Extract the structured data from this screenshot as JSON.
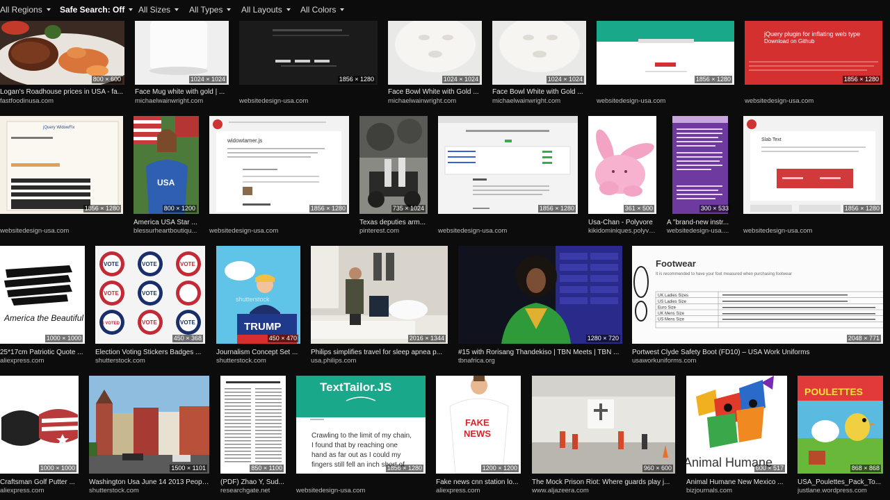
{
  "filters": [
    {
      "label": "All Regions",
      "bold": false
    },
    {
      "label": "Safe Search: Off",
      "bold": true
    },
    {
      "label": "All Sizes",
      "bold": false
    },
    {
      "label": "All Types",
      "bold": false
    },
    {
      "label": "All Layouts",
      "bold": false
    },
    {
      "label": "All Colors",
      "bold": false
    }
  ],
  "row1": [
    {
      "dims": "800 × 600",
      "title": "Logan's Roadhouse prices in USA - fa...",
      "source": "fastfoodinusa.com"
    },
    {
      "dims": "1024 × 1024",
      "title": "Face Mug white with gold | ...",
      "source": "michaelwainwright.com"
    },
    {
      "dims": "1856 × 1280",
      "title": "",
      "source": "websitedesign-usa.com"
    },
    {
      "dims": "1024 × 1024",
      "title": "Face Bowl White with Gold ...",
      "source": "michaelwainwright.com"
    },
    {
      "dims": "1024 × 1024",
      "title": "Face Bowl White with Gold ...",
      "source": "michaelwainwright.com"
    },
    {
      "dims": "1856 × 1280",
      "title": "",
      "source": "websitedesign-usa.com"
    },
    {
      "dims": "1856 × 1280",
      "title": "",
      "source": "websitedesign-usa.com"
    }
  ],
  "row2": [
    {
      "dims": "1856 × 1280",
      "title": "",
      "source": "websitedesign-usa.com"
    },
    {
      "dims": "800 × 1200",
      "title": "America USA Star ...",
      "source": "blessurheartboutiqu..."
    },
    {
      "dims": "1856 × 1280",
      "title": "",
      "source": "websitedesign-usa.com"
    },
    {
      "dims": "735 × 1024",
      "title": "Texas deputies arm...",
      "source": "pinterest.com"
    },
    {
      "dims": "1856 × 1280",
      "title": "",
      "source": "websitedesign-usa.com"
    },
    {
      "dims": "361 × 500",
      "title": "Usa-Chan - Polyvore",
      "source": "kikidominiques.polyvo..."
    },
    {
      "dims": "300 × 533",
      "title": "A \"brand-new instr...",
      "source": "websitedesign-usa...."
    },
    {
      "dims": "1856 × 1280",
      "title": "",
      "source": "websitedesign-usa.com"
    }
  ],
  "row3": [
    {
      "dims": "1000 × 1000",
      "title": "25*17cm Patriotic Quote ...",
      "source": "aliexpress.com"
    },
    {
      "dims": "450 × 368",
      "title": "Election Voting Stickers Badges ...",
      "source": "shutterstock.com"
    },
    {
      "dims": "450 × 470",
      "title": "Journalism Concept Set ...",
      "source": "shutterstock.com"
    },
    {
      "dims": "2016 × 1344",
      "title": "Philips simplifies travel for sleep apnea p...",
      "source": "usa.philips.com"
    },
    {
      "dims": "1280 × 720",
      "title": "#15 with Rorisang Thandekiso | TBN Meets | TBN ...",
      "source": "tbnafrica.org"
    },
    {
      "dims": "2048 × 771",
      "title": "Portwest Clyde Safety Boot (FD10) – USA Work Uniforms",
      "source": "usaworkuniforms.com"
    }
  ],
  "row4": [
    {
      "dims": "1000 × 1000",
      "title": "Craftsman Golf Putter ...",
      "source": "aliexpress.com"
    },
    {
      "dims": "1500 × 1101",
      "title": "Washington Usa June 14 2013 Peopl...",
      "source": "shutterstock.com"
    },
    {
      "dims": "850 × 1100",
      "title": "(PDF) Zhao Y, Sud...",
      "source": "researchgate.net"
    },
    {
      "dims": "1856 × 1280",
      "title": "",
      "source": "websitedesign-usa.com"
    },
    {
      "dims": "1200 × 1200",
      "title": "Fake news cnn station lo...",
      "source": "aliexpress.com"
    },
    {
      "dims": "960 × 600",
      "title": "The Mock Prison Riot: Where guards play j...",
      "source": "www.aljazeera.com"
    },
    {
      "dims": "600 × 517",
      "title": "Animal Humane New Mexico ...",
      "source": "bizjournals.com"
    },
    {
      "dims": "868 × 868",
      "title": "USA_Poulettes_Pack_To...",
      "source": "justlane.wordpress.com"
    }
  ],
  "texts": {
    "jquery_plugin": "jQuery plugin for inflating web type",
    "download_github": "Download on Github",
    "jquery_widow": "jQuery WidowFix",
    "widowtamer": "widowtamer.js",
    "slab_text": "Slab Text",
    "shutterstock": "shutterstock",
    "trump": "TRUMP",
    "footwear": "Footwear",
    "footwear_sub": "It is recommended to have your foot measured when purchasing footwear",
    "uk_ladies": "UK Ladies Sizes",
    "us_ladies": "US Ladies Size",
    "euro_size": "Euro Size",
    "uk_mens": "UK Mens Size",
    "us_mens": "US Mens Size",
    "america_beautiful": "America the Beautiful",
    "vote": "VOTE",
    "voted": "I VOTED",
    "texttailor": "TextTailor.JS",
    "crawling_1": "Crawling to the limit of my chain,",
    "crawling_2": "I found that by reaching one",
    "crawling_3": "hand as far out as I could my",
    "crawling_4": "fingers still fell an inch short of",
    "fake_1": "FAKE",
    "fake_2": "NEWS",
    "animal_humane": "Animal Humane",
    "poulettes": "POULETTES",
    "usa": "USA"
  },
  "colors": {
    "background": "#0c0c0c",
    "teal": "#1aa88a",
    "red": "#d43030",
    "slab_red": "#d03a3a"
  }
}
